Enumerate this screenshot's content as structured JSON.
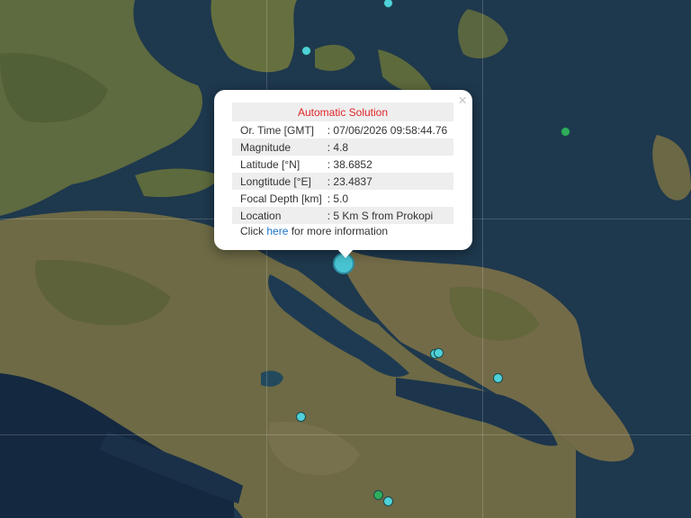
{
  "popup": {
    "title": "Automatic Solution",
    "close_glyph": "×",
    "rows": [
      {
        "label": "Or. Time [GMT]",
        "value": ": 07/06/2026 09:58:44.76"
      },
      {
        "label": "Magnitude",
        "value": ": 4.8"
      },
      {
        "label": "Latitude [°N]",
        "value": ": 38.6852"
      },
      {
        "label": "Longtitude [°E]",
        "value": ": 23.4837"
      },
      {
        "label": "Focal Depth [km]",
        "value": ": 5.0"
      },
      {
        "label": "Location",
        "value": ": 5 Km S from Prokopi"
      }
    ],
    "more_prefix": "Click ",
    "more_link": "here",
    "more_suffix": " for more information"
  },
  "colors": {
    "marker_teal": "#4fd1d9",
    "marker_green": "#2fae5b",
    "title_red": "#e0262a",
    "link_blue": "#1a73c7"
  },
  "markers": [
    {
      "type": "selected-event",
      "color": "teal"
    },
    {
      "type": "event",
      "color": "teal"
    },
    {
      "type": "event",
      "color": "teal"
    },
    {
      "type": "event",
      "color": "teal"
    },
    {
      "type": "event",
      "color": "teal"
    },
    {
      "type": "event",
      "color": "teal"
    },
    {
      "type": "event",
      "color": "teal"
    },
    {
      "type": "event",
      "color": "teal"
    },
    {
      "type": "event",
      "color": "green"
    },
    {
      "type": "event",
      "color": "green"
    }
  ]
}
